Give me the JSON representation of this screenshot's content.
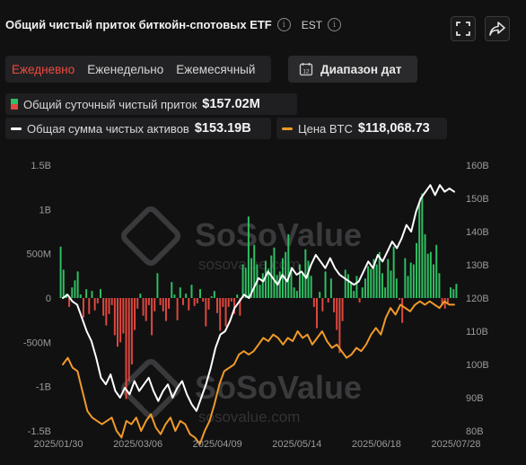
{
  "header": {
    "title": "Общий чистый приток биткойн-спотовых ETF",
    "timezone": "EST"
  },
  "periods": [
    {
      "label": "Ежедневно",
      "active": true
    },
    {
      "label": "Еженедельно",
      "active": false
    },
    {
      "label": "Ежемесячный",
      "active": false
    }
  ],
  "date_range": {
    "label": "Диапазон дат",
    "icon_text": "12"
  },
  "legend": {
    "daily": {
      "name": "Общий суточный чистый приток",
      "value": "$157.02M"
    },
    "assets": {
      "name": "Общая сумма чистых активов",
      "value": "$153.19B"
    },
    "btc": {
      "name": "Цена BTC",
      "value": "$118,068.73"
    }
  },
  "watermark": {
    "brand": "SoSoValue",
    "url": "sosovalue.com"
  },
  "colors": {
    "inflow": "#2fbf62",
    "outflow": "#e0483e",
    "assets_line": "#ffffff",
    "btc_line": "#f09a28",
    "active_tab": "#ef4b3f"
  },
  "chart_data": {
    "type": "bar+line",
    "x_ticks": [
      "2025/01/30",
      "2025/03/06",
      "2025/04/09",
      "2025/05/14",
      "2025/06/18",
      "2025/07/28"
    ],
    "left_axis": {
      "ticks": [
        "1.5B",
        "1B",
        "500M",
        "0",
        "-500M",
        "-1B",
        "-1.5B"
      ],
      "range": [
        -1.5,
        1.5
      ],
      "unit": "B USD"
    },
    "right_axis": {
      "ticks": [
        "160B",
        "150B",
        "140B",
        "130B",
        "120B",
        "110B",
        "100B",
        "90B",
        "80B"
      ],
      "range": [
        80,
        160
      ],
      "unit": "B USD"
    },
    "series": [
      {
        "name": "Общий суточный чистый приток",
        "axis": "left",
        "values": [
          0.58,
          0.32,
          0.05,
          -0.1,
          0.12,
          0.2,
          0.3,
          0.04,
          -0.22,
          0.1,
          -0.18,
          0.08,
          -0.14,
          -0.06,
          0.1,
          -0.2,
          -0.31,
          -0.18,
          -0.08,
          -0.42,
          -0.55,
          -0.5,
          -0.4,
          -1.14,
          -0.94,
          -0.75,
          -0.36,
          -0.12,
          0.05,
          -0.2,
          -0.26,
          -0.08,
          -0.42,
          -0.15,
          0.28,
          -0.08,
          -0.15,
          -0.26,
          -0.12,
          0.18,
          0.04,
          -0.25,
          0.12,
          -0.08,
          0.05,
          -0.14,
          0.15,
          -0.09,
          -0.06,
          0.1,
          -0.04,
          -0.32,
          -0.13,
          0.02,
          0.08,
          -0.17,
          -0.37,
          -0.1,
          -0.32,
          -0.1,
          -0.04,
          -0.18,
          0.04,
          -0.2,
          0.38,
          0.34,
          0.92,
          0.45,
          0.6,
          0.38,
          0.15,
          0.28,
          0.42,
          0.33,
          0.48,
          0.57,
          0.26,
          0.3,
          0.45,
          0.52,
          0.72,
          0.35,
          0.12,
          0.08,
          0.38,
          0.28,
          0.55,
          0.42,
          0.25,
          -0.1,
          -0.34,
          0.07,
          -0.15,
          0.3,
          -0.05,
          0.22,
          -0.16,
          -0.36,
          -0.62,
          -0.26,
          0.32,
          0.27,
          0.18,
          0.08,
          0.25,
          -0.05,
          0.12,
          0.22,
          0.36,
          0.33,
          0.44,
          0.38,
          0.52,
          0.28,
          0.12,
          0.44,
          0.31,
          0.58,
          0.22,
          -0.02,
          -0.28,
          0.45,
          0.25,
          0.4,
          0.38,
          0.62,
          1.08,
          1.18,
          0.72,
          0.5,
          0.52,
          0.38,
          0.6,
          0.28,
          -0.08,
          -0.12,
          -0.06,
          0.12,
          0.1,
          0.16
        ]
      },
      {
        "name": "Общая сумма чистых активов",
        "axis": "right",
        "values": [
          120,
          121,
          119,
          118,
          114,
          110,
          107,
          102,
          96,
          94,
          97,
          92,
          90,
          93,
          91,
          95,
          92,
          94,
          96,
          92,
          89,
          92,
          94,
          90,
          93,
          95,
          91,
          88,
          86,
          90,
          94,
          99,
          105,
          109,
          110,
          113,
          117,
          119,
          121,
          120,
          123,
          126,
          125,
          128,
          126,
          124,
          127,
          125,
          129,
          127,
          128,
          126,
          130,
          133,
          131,
          129,
          132,
          129,
          127,
          126,
          125,
          124,
          125,
          128,
          131,
          129,
          133,
          131,
          134,
          137,
          135,
          138,
          142,
          140,
          146,
          150,
          152,
          154,
          151,
          154,
          152,
          153,
          152
        ]
      },
      {
        "name": "Цена BTC",
        "axis": "right",
        "values": [
          100,
          102,
          99,
          98,
          92,
          86,
          84,
          83,
          82,
          83,
          84,
          80,
          78,
          83,
          82,
          84,
          80,
          83,
          85,
          81,
          79,
          82,
          84,
          80,
          83,
          82,
          79,
          78,
          76,
          80,
          83,
          88,
          94,
          98,
          99,
          100,
          103,
          104,
          103,
          104,
          106,
          108,
          107,
          109,
          108,
          106,
          108,
          107,
          110,
          108,
          109,
          106,
          108,
          110,
          107,
          105,
          106,
          104,
          102,
          103,
          105,
          104,
          106,
          109,
          111,
          109,
          114,
          117,
          115,
          118,
          117,
          116,
          118,
          119,
          118,
          119,
          118,
          117,
          119,
          118,
          118
        ]
      }
    ]
  }
}
